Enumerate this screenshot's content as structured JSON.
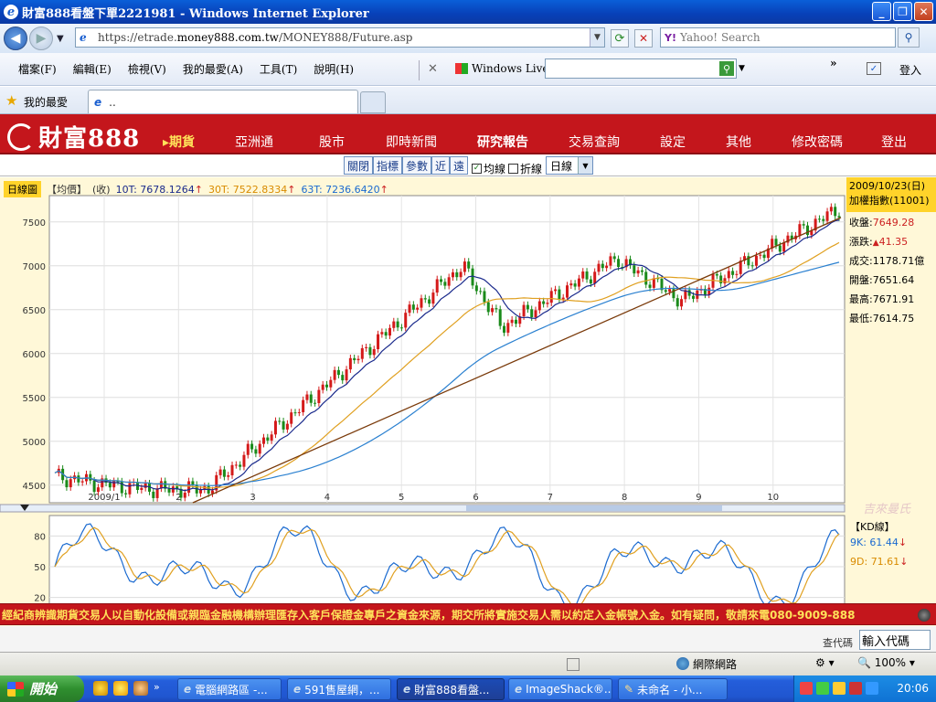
{
  "window": {
    "title": "財富888看盤下單2221981 - Windows Internet Explorer"
  },
  "address": {
    "prefix": "https://etrade.",
    "domain": "money888.com.tw",
    "path": "/MONEY888/Future.asp"
  },
  "search": {
    "placeholder": "Yahoo! Search"
  },
  "menu": [
    "檔案(F)",
    "編輯(E)",
    "檢視(V)",
    "我的最愛(A)",
    "工具(T)",
    "說明(H)"
  ],
  "windows_live": {
    "label": "Windows Live",
    "login": "登入"
  },
  "favorites": {
    "label": "我的最愛",
    "tab_title": ".."
  },
  "site": {
    "logo": "財富888",
    "nav": [
      "▸期貨",
      "亞洲通",
      "股市",
      "即時新聞",
      "研究報告",
      "交易查詢",
      "設定",
      "其他",
      "修改密碼",
      "登出"
    ]
  },
  "chart_toolbar": {
    "buttons": [
      "關閉",
      "指標",
      "參數",
      "近",
      "遠"
    ],
    "check_ma": "均線",
    "check_line": "折線",
    "period": "日線"
  },
  "info": {
    "label": "日線圖",
    "type": "【均價】",
    "close": "(收)",
    "ma10": "10T: 7678.1264",
    "ma30": "30T: 7522.8334",
    "ma63": "63T: 7236.6420",
    "arrow": "↑"
  },
  "side": {
    "date": "2009/10/23(日)",
    "index": "加權指數(11001)",
    "close_label": "收盤:",
    "close": "7649.28",
    "change_label": "漲跌:",
    "change": "41.35",
    "volume_label": "成交:",
    "volume": "1178.71億",
    "open_label": "開盤:",
    "open": "7651.64",
    "high_label": "最高:",
    "high": "7671.91",
    "low_label": "最低:",
    "low": "7614.75",
    "kd_label": "【KD線】",
    "k_label": "9K:",
    "k_value": "61.44",
    "d_label": "9D:",
    "d_value": "71.61",
    "arrow_down": "↓",
    "watermark": "吉來曼氏"
  },
  "chart_data": {
    "type": "candlestick",
    "ylim": [
      4300,
      7800
    ],
    "yticks": [
      4500,
      5000,
      5500,
      6000,
      6500,
      7000,
      7500
    ],
    "xticks": [
      "2009/1",
      "2",
      "3",
      "4",
      "5",
      "6",
      "7",
      "8",
      "9",
      "10"
    ],
    "series": [
      {
        "name": "10T",
        "color": "#1a2a8c"
      },
      {
        "name": "30T",
        "color": "#e0a020"
      },
      {
        "name": "63T",
        "color": "#2a80d0"
      }
    ],
    "kd": {
      "yticks": [
        20,
        50,
        80
      ],
      "ylim": [
        0,
        100
      ]
    }
  },
  "ticker": "經紀商辨識期貨交易人以自動化設備或親臨金融機構辦理匯存入客戶保證金專戶之資金來源，期交所將實施交易人需以約定入金帳號入金。如有疑問，敬請來電080-9009-888",
  "code": {
    "label": "查代碼",
    "placeholder": "輸入代碼"
  },
  "status": {
    "zone": "網際網路",
    "zoom": "100%"
  },
  "taskbar": {
    "start": "開始",
    "tasks": [
      "電腦網路區 -...",
      "591售屋網，...",
      "財富888看盤...",
      "ImageShack®...",
      "未命名 - 小..."
    ],
    "clock": "20:06"
  }
}
